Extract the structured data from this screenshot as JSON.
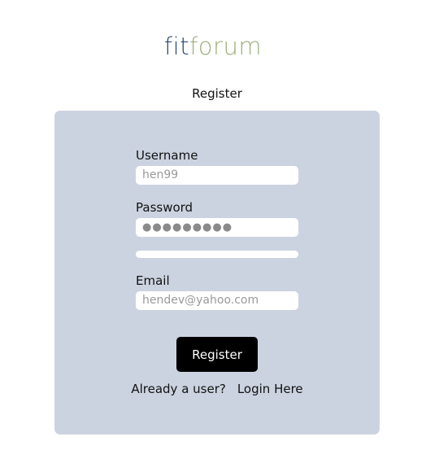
{
  "brand": {
    "part1": "fit",
    "part2": "forum"
  },
  "page_heading": "Register",
  "form": {
    "username_label": "Username",
    "username_value": "hen99",
    "password_label": "Password",
    "password_value": "●●●●●●●●●",
    "email_label": "Email",
    "email_value": "hendev@yahoo.com",
    "submit_label": "Register"
  },
  "footer": {
    "prompt": "Already a user?",
    "login_link": "Login Here"
  },
  "colors": {
    "brand_dark": "#2e4a78",
    "brand_light": "#9bb07a",
    "card_bg": "#ccd3e0",
    "button_bg": "#000000"
  }
}
